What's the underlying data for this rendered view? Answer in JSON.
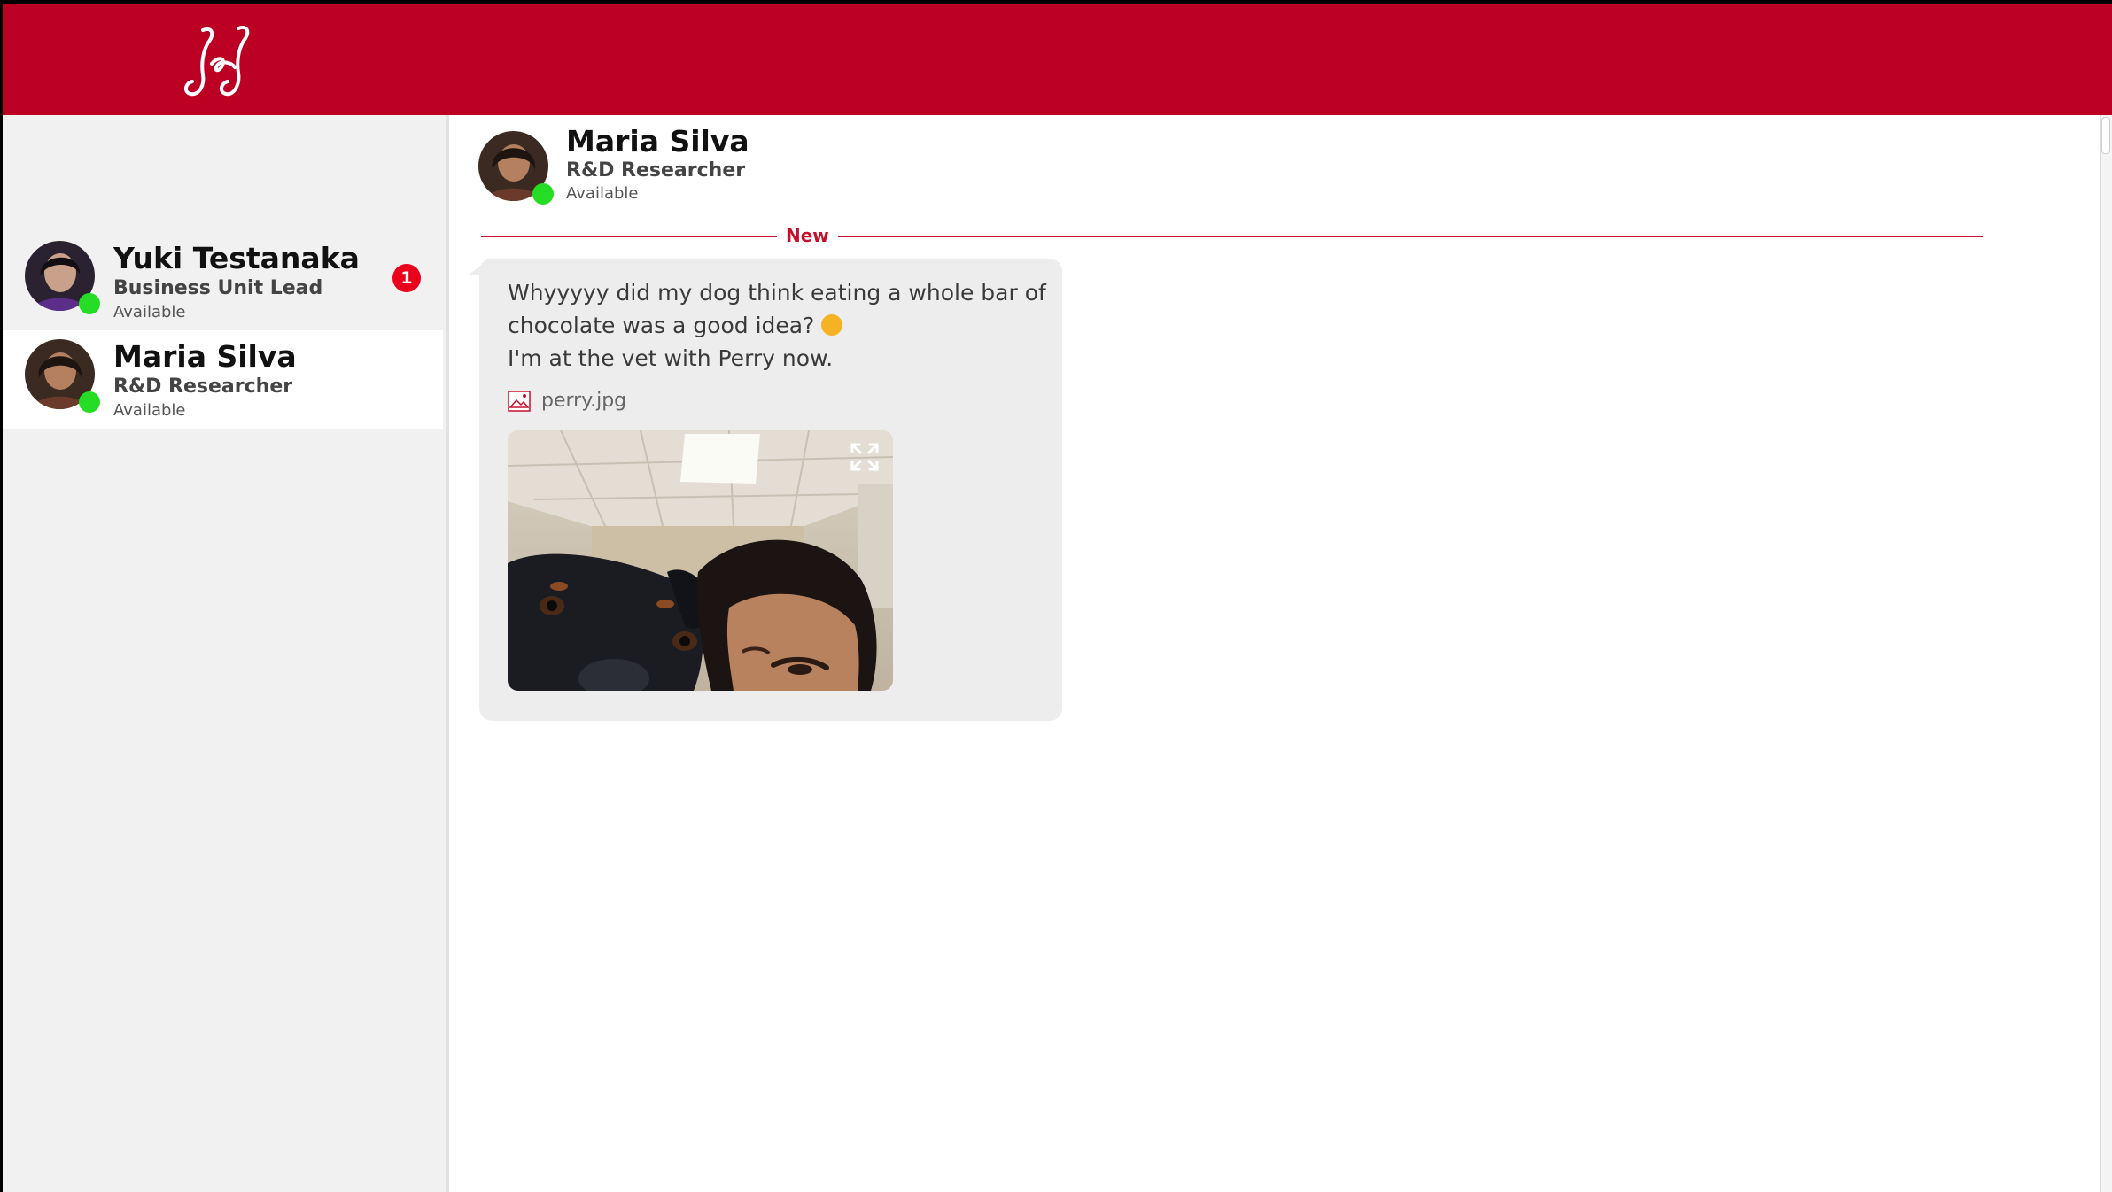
{
  "header": {
    "logo_text": "J&J",
    "brand_color": "#bc0023"
  },
  "contacts": [
    {
      "name": "Yuki Testanaka",
      "role": "Business Unit Lead",
      "status": "Available",
      "unread": "1",
      "active": false
    },
    {
      "name": "Maria Silva",
      "role": "R&D Researcher",
      "status": "Available",
      "unread": "",
      "active": true
    }
  ],
  "chat": {
    "name": "Maria Silva",
    "role": "R&D Researcher",
    "status": "Available",
    "divider_label": "New",
    "message": {
      "line1": "Whyyyyy did my dog think eating a whole bar of chocolate was a good idea?",
      "line2": "I'm at the vet with Perry now.",
      "emoji": "weary-face-emoji",
      "attachment_name": "perry.jpg"
    }
  },
  "colors": {
    "accent": "#c8102e",
    "online": "#24dd24",
    "badge": "#e8001c"
  }
}
